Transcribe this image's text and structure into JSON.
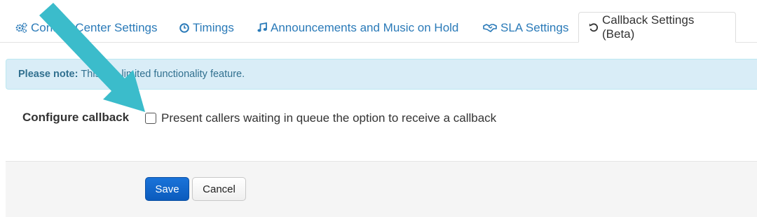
{
  "tabs": [
    {
      "label": "Contact Center Settings",
      "icon": "gears-icon",
      "active": false
    },
    {
      "label": "Timings",
      "icon": "clock-icon",
      "active": false
    },
    {
      "label": "Announcements and Music on Hold",
      "icon": "music-note-icon",
      "active": false
    },
    {
      "label": "SLA Settings",
      "icon": "handshake-icon",
      "active": false
    },
    {
      "label": "Callback Settings (Beta)",
      "icon": "undo-icon",
      "active": true
    }
  ],
  "notice": {
    "prefix": "Please note:",
    "text": "This is a limited functionality feature."
  },
  "form": {
    "label": "Configure callback",
    "checkbox_label": "Present callers waiting in queue the option to receive a callback",
    "checked": false
  },
  "buttons": {
    "save": "Save",
    "cancel": "Cancel"
  },
  "colors": {
    "link": "#2a7ab8",
    "notice_bg": "#d9edf7",
    "notice_text": "#31708f",
    "save_bg": "#1a73d9",
    "annotation_arrow": "#3bbccb"
  }
}
